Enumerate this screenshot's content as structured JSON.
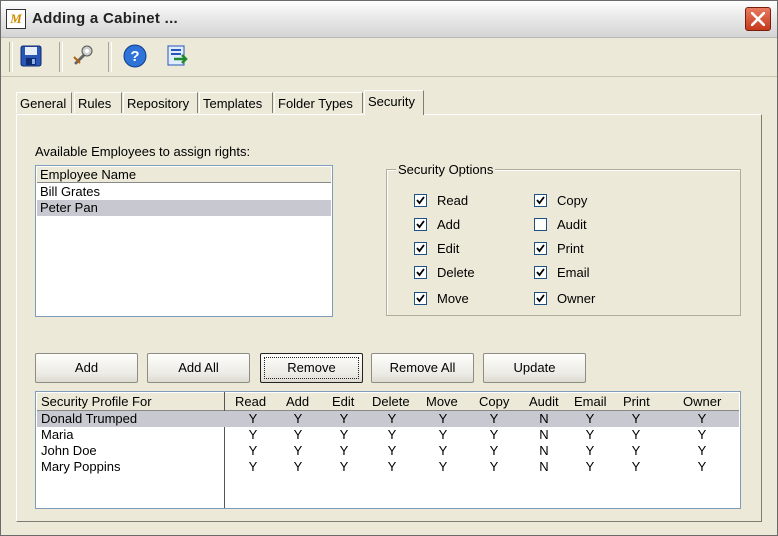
{
  "window": {
    "title": "Adding a Cabinet ...",
    "app_icon_text": "M"
  },
  "toolbar": {
    "buttons": [
      "save-icon",
      "tools-icon",
      "help-icon",
      "export-icon"
    ]
  },
  "tabs": [
    {
      "label": "General",
      "active": false
    },
    {
      "label": "Rules",
      "active": false
    },
    {
      "label": "Repository",
      "active": false
    },
    {
      "label": "Templates",
      "active": false
    },
    {
      "label": "Folder Types",
      "active": false
    },
    {
      "label": "Security",
      "active": true
    }
  ],
  "employees": {
    "caption": "Available Employees to assign rights:",
    "header": "Employee Name",
    "rows": [
      {
        "name": "Bill Grates",
        "selected": false
      },
      {
        "name": "Peter Pan",
        "selected": true
      }
    ]
  },
  "security_options": {
    "title": "Security Options",
    "items": [
      {
        "label": "Read",
        "checked": true
      },
      {
        "label": "Add",
        "checked": true
      },
      {
        "label": "Edit",
        "checked": true
      },
      {
        "label": "Delete",
        "checked": true
      },
      {
        "label": "Move",
        "checked": true
      },
      {
        "label": "Copy",
        "checked": true
      },
      {
        "label": "Audit",
        "checked": false
      },
      {
        "label": "Print",
        "checked": true
      },
      {
        "label": "Email",
        "checked": true
      },
      {
        "label": "Owner",
        "checked": true
      }
    ]
  },
  "buttons": {
    "add": "Add",
    "add_all": "Add All",
    "remove": "Remove",
    "remove_all": "Remove All",
    "update": "Update"
  },
  "profile_grid": {
    "columns": [
      "Security Profile For",
      "Read",
      "Add",
      "Edit",
      "Delete",
      "Move",
      "Copy",
      "Audit",
      "Email",
      "Print",
      "Owner"
    ],
    "rows": [
      {
        "name": "Donald Trumped",
        "values": [
          "Y",
          "Y",
          "Y",
          "Y",
          "Y",
          "Y",
          "N",
          "Y",
          "Y",
          "Y"
        ],
        "selected": true
      },
      {
        "name": "Maria",
        "values": [
          "Y",
          "Y",
          "Y",
          "Y",
          "Y",
          "Y",
          "N",
          "Y",
          "Y",
          "Y"
        ],
        "selected": false
      },
      {
        "name": "John Doe",
        "values": [
          "Y",
          "Y",
          "Y",
          "Y",
          "Y",
          "Y",
          "N",
          "Y",
          "Y",
          "Y"
        ],
        "selected": false
      },
      {
        "name": "Mary Poppins",
        "values": [
          "Y",
          "Y",
          "Y",
          "Y",
          "Y",
          "Y",
          "N",
          "Y",
          "Y",
          "Y"
        ],
        "selected": false
      }
    ]
  },
  "colors": {
    "selection": "#c8c8d0",
    "close": "#c5381c",
    "face": "#ECE9D8"
  }
}
